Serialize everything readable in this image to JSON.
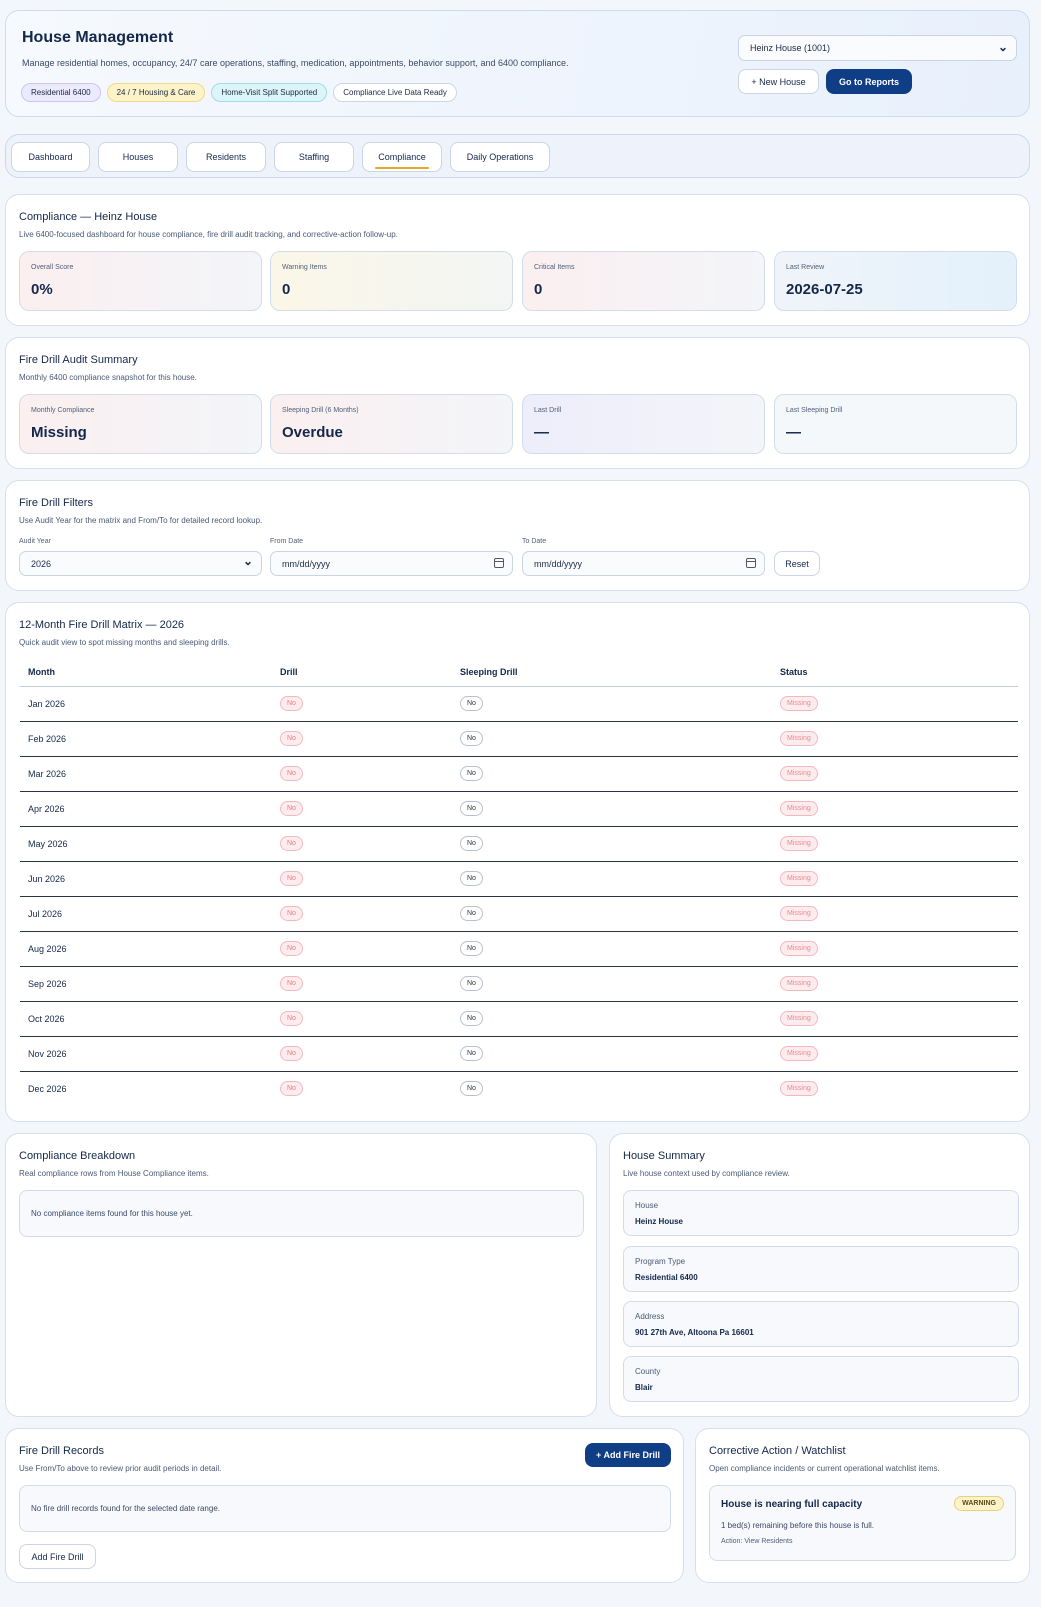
{
  "header": {
    "title": "House Management",
    "subtitle": "Manage residential homes, occupancy, 24/7 care operations, staffing, medication, appointments, behavior support, and 6400 compliance.",
    "badges": [
      "Residential 6400",
      "24 / 7 Housing & Care",
      "Home-Visit Split Supported",
      "Compliance Live Data Ready"
    ],
    "house_select": "Heinz House (1001)",
    "new_house_label": "+ New House",
    "reports_label": "Go to Reports"
  },
  "tabs": [
    "Dashboard",
    "Houses",
    "Residents",
    "Staffing",
    "Compliance",
    "Daily Operations"
  ],
  "active_tab": "Compliance",
  "compliance": {
    "title": "Compliance — Heinz House",
    "subtitle": "Live 6400-focused dashboard for house compliance, fire drill audit tracking, and corrective-action follow-up.",
    "stats": [
      {
        "label": "Overall Score",
        "value": "0%"
      },
      {
        "label": "Warning Items",
        "value": "0"
      },
      {
        "label": "Critical Items",
        "value": "0"
      },
      {
        "label": "Last Review",
        "value": "2026-07-25"
      }
    ]
  },
  "audit": {
    "title": "Fire Drill Audit Summary",
    "subtitle": "Monthly 6400 compliance snapshot for this house.",
    "stats": [
      {
        "label": "Monthly Compliance",
        "value": "Missing"
      },
      {
        "label": "Sleeping Drill (6 Months)",
        "value": "Overdue"
      },
      {
        "label": "Last Drill",
        "value": "—"
      },
      {
        "label": "Last Sleeping Drill",
        "value": "—"
      }
    ]
  },
  "filters": {
    "title": "Fire Drill Filters",
    "subtitle": "Use Audit Year for the matrix and From/To for detailed record lookup.",
    "audit_year_label": "Audit Year",
    "audit_year_value": "2026",
    "from_label": "From Date",
    "from_placeholder": "mm/dd/yyyy",
    "to_label": "To Date",
    "to_placeholder": "mm/dd/yyyy",
    "reset_label": "Reset"
  },
  "matrix": {
    "title": "12-Month Fire Drill Matrix — 2026",
    "subtitle": "Quick audit view to spot missing months and sleeping drills.",
    "columns": [
      "Month",
      "Drill",
      "Sleeping Drill",
      "Status"
    ],
    "rows": [
      {
        "month": "Jan 2026",
        "drill": "No",
        "sleeping": "No",
        "status": "Missing"
      },
      {
        "month": "Feb 2026",
        "drill": "No",
        "sleeping": "No",
        "status": "Missing"
      },
      {
        "month": "Mar 2026",
        "drill": "No",
        "sleeping": "No",
        "status": "Missing"
      },
      {
        "month": "Apr 2026",
        "drill": "No",
        "sleeping": "No",
        "status": "Missing"
      },
      {
        "month": "May 2026",
        "drill": "No",
        "sleeping": "No",
        "status": "Missing"
      },
      {
        "month": "Jun 2026",
        "drill": "No",
        "sleeping": "No",
        "status": "Missing"
      },
      {
        "month": "Jul 2026",
        "drill": "No",
        "sleeping": "No",
        "status": "Missing"
      },
      {
        "month": "Aug 2026",
        "drill": "No",
        "sleeping": "No",
        "status": "Missing"
      },
      {
        "month": "Sep 2026",
        "drill": "No",
        "sleeping": "No",
        "status": "Missing"
      },
      {
        "month": "Oct 2026",
        "drill": "No",
        "sleeping": "No",
        "status": "Missing"
      },
      {
        "month": "Nov 2026",
        "drill": "No",
        "sleeping": "No",
        "status": "Missing"
      },
      {
        "month": "Dec 2026",
        "drill": "No",
        "sleeping": "No",
        "status": "Missing"
      }
    ]
  },
  "breakdown": {
    "title": "Compliance Breakdown",
    "subtitle": "Real compliance rows from House Compliance items.",
    "empty": "No compliance items found for this house yet."
  },
  "summary": {
    "title": "House Summary",
    "subtitle": "Live house context used by compliance review.",
    "fields": [
      {
        "label": "House",
        "value": "Heinz House"
      },
      {
        "label": "Program Type",
        "value": "Residential 6400"
      },
      {
        "label": "Address",
        "value": "901 27th Ave, Altoona Pa 16601"
      },
      {
        "label": "County",
        "value": "Blair"
      }
    ]
  },
  "records": {
    "title": "Fire Drill Records",
    "subtitle": "Use From/To above to review prior audit periods in detail.",
    "add_top_label": "+ Add Fire Drill",
    "empty": "No fire drill records found for the selected date range.",
    "add_bottom_label": "Add Fire Drill"
  },
  "watchlist": {
    "title": "Corrective Action / Watchlist",
    "subtitle": "Open compliance incidents or current operational watchlist items.",
    "item": {
      "title": "House is nearing full capacity",
      "badge": "WARNING",
      "detail": "1 bed(s) remaining before this house is full.",
      "action": "Action: View Residents"
    }
  }
}
